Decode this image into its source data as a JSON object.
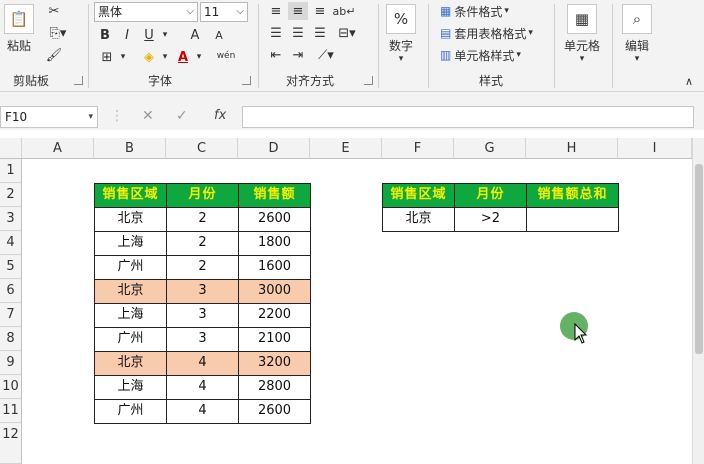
{
  "ribbon": {
    "clipboard": {
      "label": "剪贴板",
      "paste_label": "粘贴"
    },
    "font": {
      "label": "字体",
      "name": "黑体",
      "size": "11",
      "bold": "B",
      "italic": "I",
      "underline": "U",
      "grow": "A",
      "shrink": "A",
      "phonetic": "wén"
    },
    "alignment": {
      "label": "对齐方式"
    },
    "number": {
      "label": "数字",
      "icon_text": "%"
    },
    "styles": {
      "label": "样式",
      "conditional": "条件格式",
      "table_format": "套用表格格式",
      "cell_styles": "单元格样式"
    },
    "cells": {
      "label": "单元格"
    },
    "editing": {
      "label": "编辑"
    }
  },
  "formula_bar": {
    "name_box": "F10",
    "cancel": "✕",
    "enter": "✓",
    "fx": "fx",
    "content": ""
  },
  "columns": [
    "A",
    "B",
    "C",
    "D",
    "E",
    "F",
    "G",
    "H",
    "I"
  ],
  "rows": [
    "1",
    "2",
    "3",
    "4",
    "5",
    "6",
    "7",
    "8",
    "9",
    "10",
    "11",
    "12"
  ],
  "table1": {
    "headers": [
      "销售区域",
      "月份",
      "销售额"
    ],
    "rows": [
      [
        "北京",
        "2",
        "2600"
      ],
      [
        "上海",
        "2",
        "1800"
      ],
      [
        "广州",
        "2",
        "1600"
      ],
      [
        "北京",
        "3",
        "3000"
      ],
      [
        "上海",
        "3",
        "2200"
      ],
      [
        "广州",
        "3",
        "2100"
      ],
      [
        "北京",
        "4",
        "3200"
      ],
      [
        "上海",
        "4",
        "2800"
      ],
      [
        "广州",
        "4",
        "2600"
      ]
    ],
    "highlight_rows": [
      3,
      6
    ]
  },
  "table2": {
    "headers": [
      "销售区域",
      "月份",
      "销售额总和"
    ],
    "row": [
      "北京",
      ">2",
      ""
    ]
  },
  "colors": {
    "header_bg": "#0fa83e",
    "header_text": "#f6f000",
    "highlight": "#f8cbad"
  }
}
